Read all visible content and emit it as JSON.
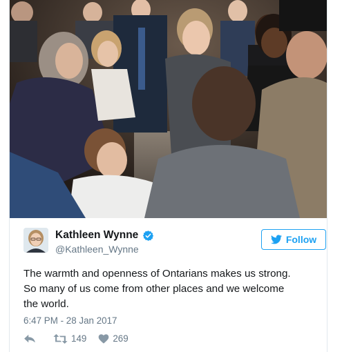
{
  "tweet": {
    "photo_icon": "event-crowd-photo",
    "author": {
      "display_name": "Kathleen Wynne",
      "handle": "@Kathleen_Wynne",
      "verified": true,
      "avatar_icon": "profile-avatar"
    },
    "follow_button": {
      "label": "Follow",
      "icon": "twitter-bird-icon"
    },
    "text_lines": [
      "The warmth and openness of Ontarians makes us strong.",
      "So many of us come from other places and we welcome",
      "the world."
    ],
    "timestamp": "6:47 PM - 28 Jan 2017",
    "actions": {
      "reply_icon": "reply-icon",
      "retweet_icon": "retweet-icon",
      "retweet_count": "149",
      "like_icon": "heart-icon",
      "like_count": "269"
    }
  },
  "colors": {
    "twitter_blue": "#1da1f2",
    "text": "#14171a",
    "secondary_text": "#657786",
    "border": "#e1e8ed"
  }
}
